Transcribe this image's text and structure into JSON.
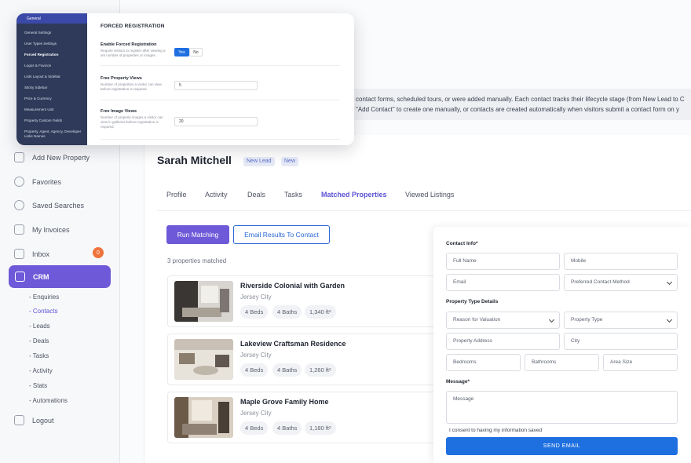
{
  "sidebar": {
    "items": [
      {
        "label": "Add New Property",
        "icon": "plus-square-icon"
      },
      {
        "label": "Favorites",
        "icon": "heart-icon"
      },
      {
        "label": "Saved Searches",
        "icon": "search-icon"
      },
      {
        "label": "My Invoices",
        "icon": "invoice-icon"
      },
      {
        "label": "Inbox",
        "icon": "inbox-icon",
        "badge": "0"
      },
      {
        "label": "CRM",
        "icon": "crm-icon"
      },
      {
        "label": "Logout",
        "icon": "logout-icon"
      }
    ],
    "crm_subitems": [
      "- Enquiries",
      "- Contacts",
      "- Leads",
      "- Deals",
      "- Tasks",
      "- Activity",
      "- Stats",
      "- Automations"
    ],
    "active_subitem": "- Contacts",
    "accent": "#6e5ad8"
  },
  "info_text": {
    "line1": "contact forms, scheduled tours, or were added manually. Each contact tracks their lifecycle stage (from New Lead to C",
    "line2": "\"Add Contact\" to create one manually, or contacts are created automatically when visitors submit a contact form on y"
  },
  "contact": {
    "name": "Sarah Mitchell",
    "tags": [
      "New Lead",
      "New"
    ]
  },
  "tabs": [
    "Profile",
    "Activity",
    "Deals",
    "Tasks",
    "Matched Properties",
    "Viewed Listings"
  ],
  "active_tab": "Matched Properties",
  "actions": {
    "run_matching": "Run Matching",
    "email_results": "Email Results To Contact"
  },
  "matched_count": "3 properties matched",
  "properties": [
    {
      "title": "Riverside Colonial with Garden",
      "city": "Jersey City",
      "beds": "4 Beds",
      "baths": "4 Baths",
      "area": "1,340 ft²"
    },
    {
      "title": "Lakeview Craftsman Residence",
      "city": "Jersey City",
      "beds": "4 Beds",
      "baths": "4 Baths",
      "area": "1,260 ft²"
    },
    {
      "title": "Maple Grove Family Home",
      "city": "Jersey City",
      "beds": "4 Beds",
      "baths": "4 Baths",
      "area": "1,180 ft²"
    }
  ],
  "form": {
    "contact_info_label": "Contact Info*",
    "full_name": "Full Name",
    "mobile": "Mobile",
    "email": "Email",
    "preferred_method": "Preferred Contact Method",
    "property_details_label": "Property Type Details",
    "reason": "Reason for Valuation",
    "property_type": "Property Type",
    "address": "Property Address",
    "city": "City",
    "bedrooms": "Bedrooms",
    "bathrooms": "Bathrooms",
    "area_size": "Area Size",
    "message_label": "Message*",
    "message_placeholder": "Message",
    "consent": "I consent to having my information saved",
    "send": "SEND EMAIL",
    "button_color": "#1e6fe0"
  },
  "settings_overlay": {
    "header": "General",
    "menu": [
      "General Settings",
      "User Types Settings",
      "Forced Registration",
      "Logos & Favicon",
      "Lists Layout & Sidebar",
      "Sticky Sidebar",
      "Price & Currency",
      "Measurement Unit",
      "Property Custom Fields",
      "Property, Agent, Agency, Developer Links Names"
    ],
    "active_menu": "Forced Registration",
    "title": "FORCED REGISTRATION",
    "enable_label": "Enable Forced Registration",
    "enable_desc": "Require visitors to register after viewing a set number of properties or images.",
    "yes": "Yes",
    "no": "No",
    "views_label": "Free Property Views",
    "views_desc": "Number of properties a visitor can view before registration is required.",
    "views_value": "5",
    "images_label": "Free Image Views",
    "images_desc": "Number of property images a visitor can view in galleries before registration is required.",
    "images_value": "20"
  }
}
